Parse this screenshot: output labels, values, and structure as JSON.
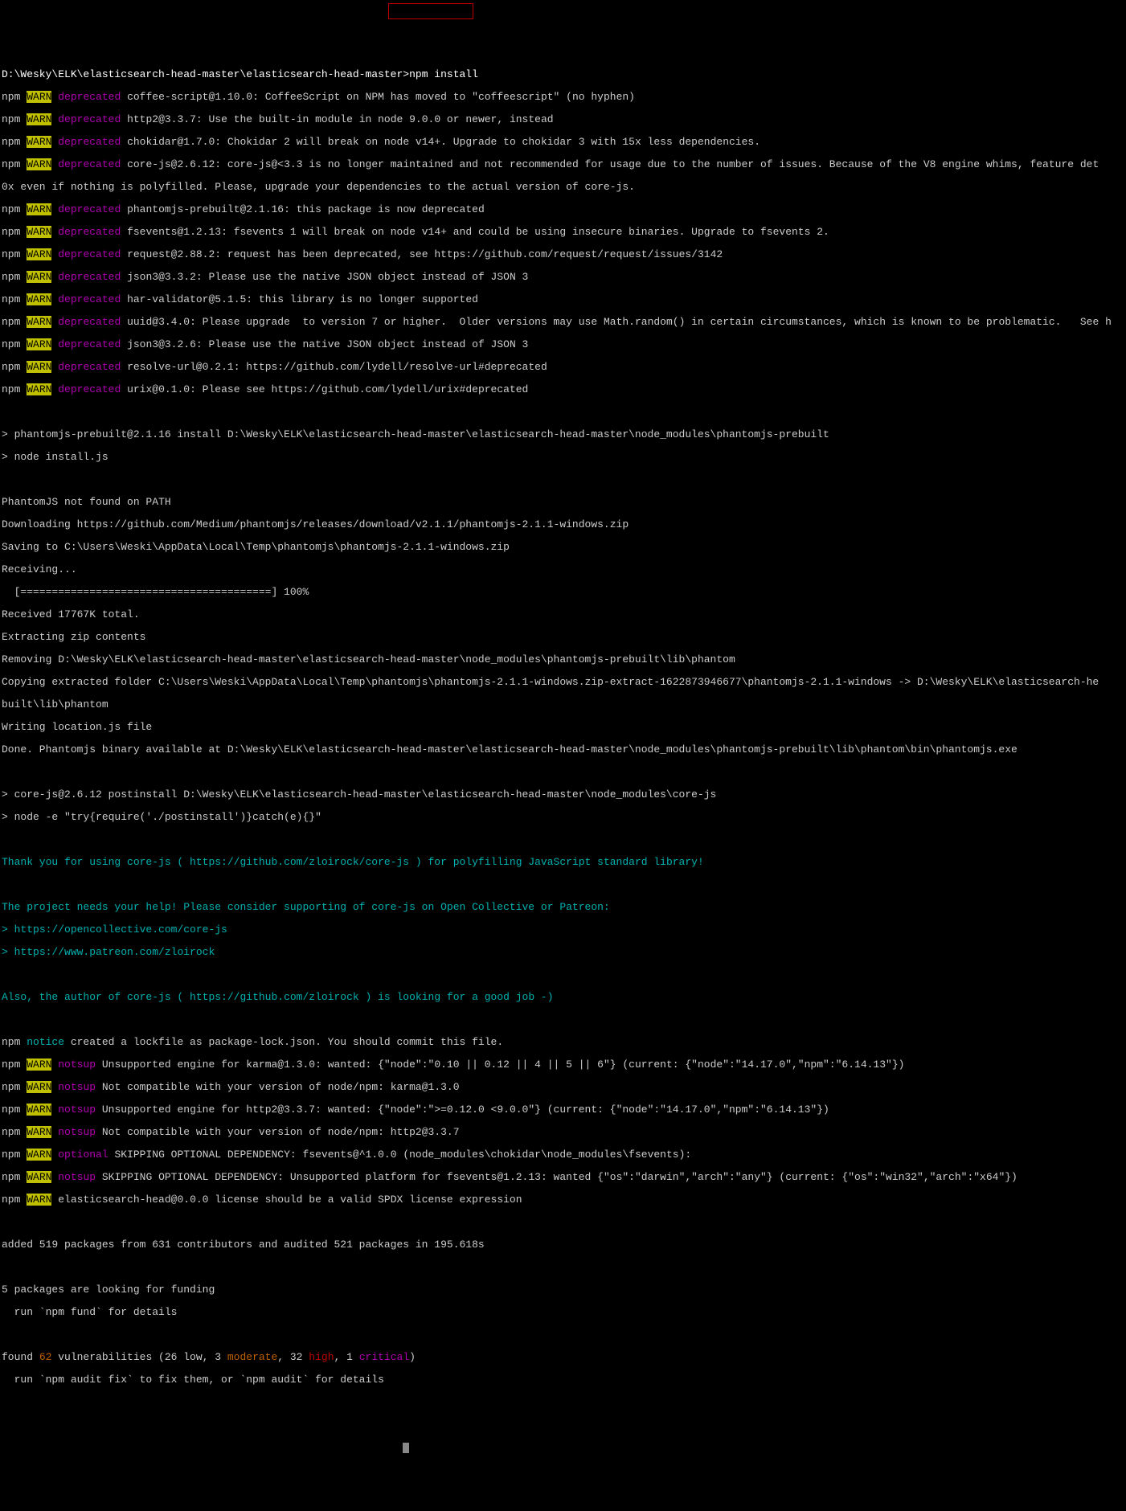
{
  "prompt_path": "D:\\Wesky\\ELK\\elasticsearch-head-master\\elasticsearch-head-master>",
  "command": "npm install",
  "np": "npm ",
  "wn": "WARN",
  "sp": " ",
  "dep": "deprecated",
  "not": "notsup",
  "opt": "optional",
  "notice": "notice",
  "d1": " coffee-script@1.10.0: CoffeeScript on NPM has moved to \"coffeescript\" (no hyphen)",
  "d2": " http2@3.3.7: Use the built-in module in node 9.0.0 or newer, instead",
  "d3": " chokidar@1.7.0: Chokidar 2 will break on node v14+. Upgrade to chokidar 3 with 15x less dependencies.",
  "d4": " core-js@2.6.12: core-js@<3.3 is no longer maintained and not recommended for usage due to the number of issues. Because of the V8 engine whims, feature det",
  "d4b": "0x even if nothing is polyfilled. Please, upgrade your dependencies to the actual version of core-js.",
  "d5": " phantomjs-prebuilt@2.1.16: this package is now deprecated",
  "d6": " fsevents@1.2.13: fsevents 1 will break on node v14+ and could be using insecure binaries. Upgrade to fsevents 2.",
  "d7": " request@2.88.2: request has been deprecated, see https://github.com/request/request/issues/3142",
  "d8": " json3@3.3.2: Please use the native JSON object instead of JSON 3",
  "d9": " har-validator@5.1.5: this library is no longer supported",
  "d10": " uuid@3.4.0: Please upgrade  to version 7 or higher.  Older versions may use Math.random() in certain circumstances, which is known to be problematic.   See h",
  "d11": " json3@3.2.6: Please use the native JSON object instead of JSON 3",
  "d12": " resolve-url@0.2.1: https://github.com/lydell/resolve-url#deprecated",
  "d13": " urix@0.1.0: Please see https://github.com/lydell/urix#deprecated",
  "pj1": "> phantomjs-prebuilt@2.1.16 install D:\\Wesky\\ELK\\elasticsearch-head-master\\elasticsearch-head-master\\node_modules\\phantomjs-prebuilt",
  "pj2": "> node install.js",
  "ph1": "PhantomJS not found on PATH",
  "ph2": "Downloading https://github.com/Medium/phantomjs/releases/download/v2.1.1/phantomjs-2.1.1-windows.zip",
  "ph3": "Saving to C:\\Users\\Weski\\AppData\\Local\\Temp\\phantomjs\\phantomjs-2.1.1-windows.zip",
  "ph4": "Receiving...",
  "ph5": "  [========================================] 100%",
  "ph6": "Received 17767K total.",
  "ph7": "Extracting zip contents",
  "ph8": "Removing D:\\Wesky\\ELK\\elasticsearch-head-master\\elasticsearch-head-master\\node_modules\\phantomjs-prebuilt\\lib\\phantom",
  "ph9": "Copying extracted folder C:\\Users\\Weski\\AppData\\Local\\Temp\\phantomjs\\phantomjs-2.1.1-windows.zip-extract-1622873946677\\phantomjs-2.1.1-windows -> D:\\Wesky\\ELK\\elasticsearch-he",
  "ph9b": "built\\lib\\phantom",
  "ph10": "Writing location.js file",
  "ph11": "Done. Phantomjs binary available at D:\\Wesky\\ELK\\elasticsearch-head-master\\elasticsearch-head-master\\node_modules\\phantomjs-prebuilt\\lib\\phantom\\bin\\phantomjs.exe",
  "cj1": "> core-js@2.6.12 postinstall D:\\Wesky\\ELK\\elasticsearch-head-master\\elasticsearch-head-master\\node_modules\\core-js",
  "cj2": "> node -e \"try{require('./postinstall')}catch(e){}\"",
  "th1a": "Thank you for using core-js (",
  "th1b": " https://github.com/zloirock/core-js ",
  "th1c": ") for polyfilling JavaScript standard library!",
  "th2": "The project needs your help! Please consider supporting of core-js on Open Collective or Patreon:",
  "th3a": "> ",
  "th3b": "https://opencollective.com/core-js",
  "th4b": "https://www.patreon.com/zloirock",
  "th5a": "Also, the author of core-js (",
  "th5b": " https://github.com/zloirock ",
  "th5c": ") is looking for a good job -)",
  "no1": " created a lockfile as package-lock.json. You should commit this file.",
  "ns1": " Unsupported engine for karma@1.3.0: wanted: {\"node\":\"0.10 || 0.12 || 4 || 5 || 6\"} (current: {\"node\":\"14.17.0\",\"npm\":\"6.14.13\"})",
  "ns2": " Not compatible with your version of node/npm: karma@1.3.0",
  "ns3": " Unsupported engine for http2@3.3.7: wanted: {\"node\":\">=0.12.0 <9.0.0\"} (current: {\"node\":\"14.17.0\",\"npm\":\"6.14.13\"})",
  "ns4": " Not compatible with your version of node/npm: http2@3.3.7",
  "op1": " SKIPPING OPTIONAL DEPENDENCY: fsevents@^1.0.0 (node_modules\\chokidar\\node_modules\\fsevents):",
  "ns5": " SKIPPING OPTIONAL DEPENDENCY: Unsupported platform for fsevents@1.2.13: wanted {\"os\":\"darwin\",\"arch\":\"any\"} (current: {\"os\":\"win32\",\"arch\":\"x64\"})",
  "lic": " elasticsearch-head@0.0.0 license should be a valid SPDX license expression",
  "add": "added 519 packages from 631 contributors and audited 521 packages in 195.618s",
  "fund1": "5 packages are looking for funding",
  "fund2": "  run `npm fund` for details",
  "vu_a": "found ",
  "vu_b": "62",
  "vu_c": " vulnerabilities (26 low, 3 ",
  "vu_d": "moderate",
  "vu_e": ", 32 ",
  "vu_f": "high",
  "vu_g": ", 1 ",
  "vu_h": "critical",
  "vu_i": ")",
  "vu2": "  run `npm audit fix` to fix them, or `npm audit` for details"
}
